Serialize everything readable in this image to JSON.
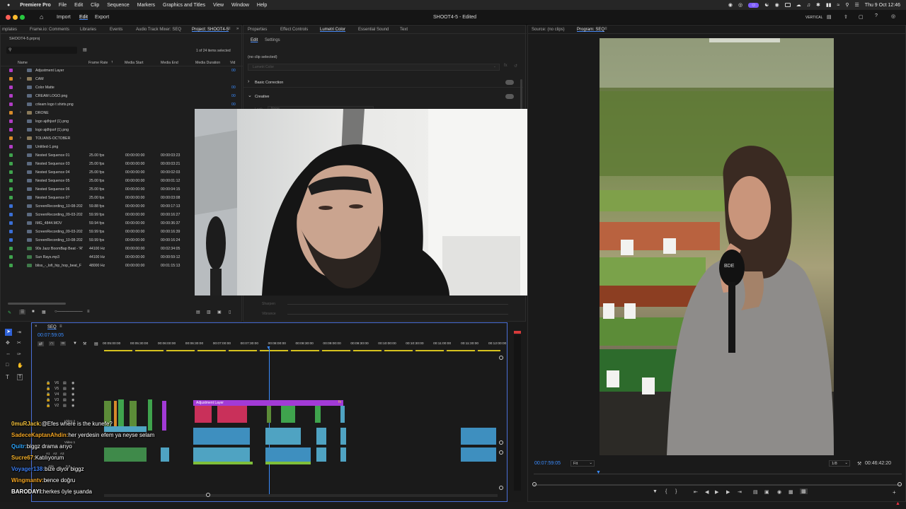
{
  "menubar": {
    "app": "Premiere Pro",
    "items": [
      "File",
      "Edit",
      "Clip",
      "Sequence",
      "Markers",
      "Graphics and Titles",
      "View",
      "Window",
      "Help"
    ],
    "vertical": "VERTICAL",
    "datetime": "Thu 9 Oct  12:46"
  },
  "titlebar": {
    "home": "Home",
    "import": "Import",
    "edit": "Edit",
    "export": "Export",
    "title": "SHOOT4-5 - Edited"
  },
  "project": {
    "tabs": [
      "mplates",
      "Frame.io: Comments",
      "Libraries",
      "Events",
      "Audio Track Mixer: SEQ",
      "Project: SHOOT4-5"
    ],
    "file": "SHOOT4-5.prproj",
    "count": "1 of 24 items selected",
    "columns": [
      "Name",
      "Frame Rate",
      "Media Start",
      "Media End",
      "Media Duration",
      "Vid"
    ],
    "rows": [
      {
        "name": "Adjustment Layer",
        "fps": "",
        "start": "",
        "end": "",
        "dur": "",
        "v": "00",
        "color": "#b03cc4",
        "type": "file"
      },
      {
        "name": "CAM",
        "fps": "",
        "start": "",
        "end": "",
        "dur": "",
        "v": "",
        "color": "#d98c2a",
        "type": "folder"
      },
      {
        "name": "Color Matte",
        "fps": "",
        "start": "",
        "end": "",
        "dur": "",
        "v": "00",
        "color": "#b03cc4",
        "type": "file"
      },
      {
        "name": "CREAM LOGO.png",
        "fps": "",
        "start": "",
        "end": "",
        "dur": "",
        "v": "00",
        "color": "#b03cc4",
        "type": "file"
      },
      {
        "name": "crleam logo t shirts.png",
        "fps": "",
        "start": "",
        "end": "",
        "dur": "",
        "v": "00",
        "color": "#b03cc4",
        "type": "file"
      },
      {
        "name": "DRONE",
        "fps": "",
        "start": "",
        "end": "",
        "dur": "",
        "v": "",
        "color": "#d98c2a",
        "type": "folder"
      },
      {
        "name": "logo ajdhjsof (1).png",
        "fps": "",
        "start": "",
        "end": "",
        "dur": "",
        "v": "",
        "color": "#b03cc4",
        "type": "file"
      },
      {
        "name": "logo ajdhjsof (1).png",
        "fps": "",
        "start": "",
        "end": "",
        "dur": "",
        "v": "",
        "color": "#b03cc4",
        "type": "file"
      },
      {
        "name": "TOLIANS-OCTOBER",
        "fps": "",
        "start": "",
        "end": "",
        "dur": "",
        "v": "",
        "color": "#d98c2a",
        "type": "folder"
      },
      {
        "name": "Untitled-1.png",
        "fps": "",
        "start": "",
        "end": "",
        "dur": "",
        "v": "",
        "color": "#b03cc4",
        "type": "file"
      },
      {
        "name": "Nested Sequence 01",
        "fps": "25.00 fps",
        "start": "00:00:00:00",
        "end": "00:00:03:23",
        "dur": "",
        "v": "",
        "color": "#3fa34d",
        "type": "seq"
      },
      {
        "name": "Nested Sequence 03",
        "fps": "25.00 fps",
        "start": "00:00:00:00",
        "end": "00:00:03:21",
        "dur": "",
        "v": "",
        "color": "#3fa34d",
        "type": "seq"
      },
      {
        "name": "Nested Sequence 04",
        "fps": "25.00 fps",
        "start": "00:00:00:00",
        "end": "00:00:02:03",
        "dur": "",
        "v": "",
        "color": "#3fa34d",
        "type": "seq"
      },
      {
        "name": "Nested Sequence 05",
        "fps": "25.00 fps",
        "start": "00:00:00:00",
        "end": "00:00:01:12",
        "dur": "",
        "v": "",
        "color": "#3fa34d",
        "type": "seq"
      },
      {
        "name": "Nested Sequence 06",
        "fps": "25.00 fps",
        "start": "00:00:00:00",
        "end": "00:00:04:15",
        "dur": "",
        "v": "",
        "color": "#3fa34d",
        "type": "seq"
      },
      {
        "name": "Nested Sequence 07",
        "fps": "25.00 fps",
        "start": "00:00:00:00",
        "end": "00:00:03:08",
        "dur": "",
        "v": "",
        "color": "#3fa34d",
        "type": "seq"
      },
      {
        "name": "ScreenRecording_10-08-202",
        "fps": "59.88 fps",
        "start": "00:00:00:00",
        "end": "00:00:17:13",
        "dur": "",
        "v": "",
        "color": "#3a6fd6",
        "type": "clip"
      },
      {
        "name": "ScreenRecording_09-03-202",
        "fps": "59.99 fps",
        "start": "00:00:00:00",
        "end": "00:00:16:27",
        "dur": "",
        "v": "",
        "color": "#3a6fd6",
        "type": "clip"
      },
      {
        "name": "IMG_4844.MOV",
        "fps": "59.94 fps",
        "start": "00:00:00:00",
        "end": "00:00:36:37",
        "dur": "",
        "v": "",
        "color": "#3a6fd6",
        "type": "clip"
      },
      {
        "name": "ScreenRecording_09-03-202",
        "fps": "59.99 fps",
        "start": "00:00:00:00",
        "end": "00:00:16:39",
        "dur": "",
        "v": "",
        "color": "#3a6fd6",
        "type": "clip"
      },
      {
        "name": "ScreenRecording_10-08-202",
        "fps": "59.99 fps",
        "start": "00:00:00:00",
        "end": "00:00:16:24",
        "dur": "",
        "v": "",
        "color": "#3a6fd6",
        "type": "clip"
      },
      {
        "name": "90s Jazz BoomBap Beat - 'R'",
        "fps": "44100 Hz",
        "start": "00:00:00:00",
        "end": "00:02:34:05",
        "dur": "",
        "v": "",
        "color": "#3fa34d",
        "type": "audio"
      },
      {
        "name": "Sun Rays.mp3",
        "fps": "44100 Hz",
        "start": "00:00:00:00",
        "end": "00:00:59:12",
        "dur": "",
        "v": "",
        "color": "#3fa34d",
        "type": "audio"
      },
      {
        "name": "bliss_-_lofi_hip_hop_beat_F",
        "fps": "48000 Hz",
        "start": "00:00:00:00",
        "end": "00:01:15:13",
        "dur": "",
        "v": "",
        "color": "#3fa34d",
        "type": "audio"
      }
    ]
  },
  "lumetri": {
    "tabs": [
      "Properties",
      "Effect Controls",
      "Lumetri Color",
      "Essential Sound",
      "Text"
    ],
    "subtabs": [
      "Edit",
      "Settings"
    ],
    "noclip": "(no clip selected)",
    "dropdown": "Lumetri Color",
    "sections": [
      "Basic Correction",
      "Creative"
    ],
    "look": "Look",
    "look_val": "None",
    "sliders": [
      "Sharpen",
      "Vibrance"
    ]
  },
  "source": {
    "tab": "Source: (no clips)"
  },
  "program": {
    "tab": "Program: SEQ",
    "timecode": "00:07:59:05",
    "fit": "Fit",
    "res": "1/8",
    "duration": "00:46:42:20",
    "logo": "BDE"
  },
  "timeline": {
    "seq": "SEQ",
    "timecode": "00:07:59:05",
    "ruler": [
      "00:05:00:00",
      "00:05:30:00",
      "00:06:00:00",
      "00:06:30:00",
      "00:07:00:00",
      "00:07:30:00",
      "00:08:00:00",
      "00:08:30:00",
      "00:09:00:00",
      "00:09:30:00",
      "00:10:00:00",
      "00:10:30:00",
      "00:11:00:00",
      "00:11:30:00",
      "00:12:00:00"
    ],
    "tracks": [
      "V6",
      "V5",
      "V4",
      "V3",
      "V2"
    ],
    "v2_label": "Video 2",
    "v1_label": "Video 1",
    "audio_labels": [
      "A1",
      "A2",
      "A3"
    ],
    "mix_label": "Mix",
    "mix_value": "0.0",
    "adj_clip": "Adjustment Layer",
    "fx_badge": "fx"
  },
  "chat": [
    {
      "user": "0muRJack:",
      "msg": "@Efes where is the kunefe?",
      "color": "#f5c23c"
    },
    {
      "user": "SadeceKaptanAhdin:",
      "msg": "her yerdesin efem ya neyse selam",
      "color": "#f5a623"
    },
    {
      "user": "Quitr:",
      "msg": "biggz drama arıyo",
      "color": "#2fa8ff"
    },
    {
      "user": "Sucre67:",
      "msg": "Katılıyorum",
      "color": "#f7b32b"
    },
    {
      "user": "Voyager138:",
      "msg": "bize diyor biggz",
      "color": "#3c7df0"
    },
    {
      "user": "Wingmantv:",
      "msg": "bence doğru",
      "color": "#f5a623"
    },
    {
      "user": "BARODAYI:",
      "msg": "herkes öyle şuanda",
      "color": "#ffffff"
    }
  ]
}
